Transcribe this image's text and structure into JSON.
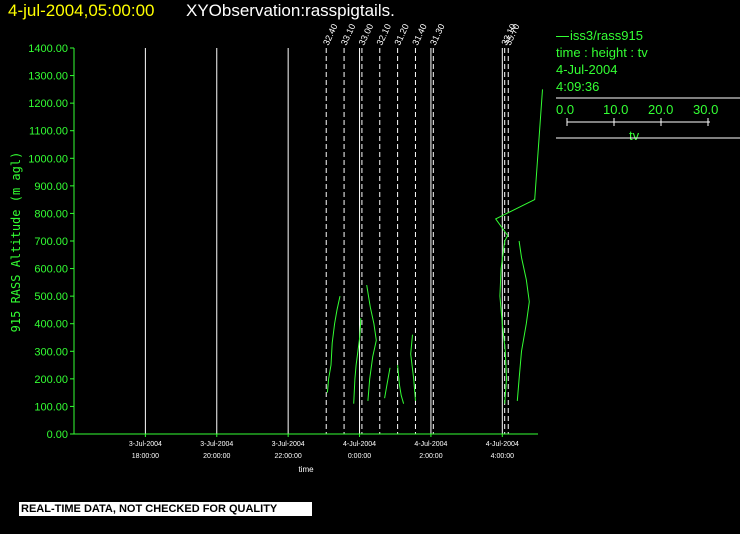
{
  "header": {
    "time_label": "4-jul-2004,05:00:00",
    "observation_label": "XYObservation:rasspigtails."
  },
  "legend": {
    "series_label": "iss3/rass915",
    "axes_label": "time : height : tv",
    "date": "4-Jul-2004",
    "time": "4:09:36",
    "scale_ticks": [
      "0.0",
      "10.0",
      "20.0",
      "30.0"
    ],
    "scale_label": "tv"
  },
  "footer": {
    "warning": "REAL-TIME DATA, NOT CHECKED FOR QUALITY"
  },
  "colors": {
    "background": "#000000",
    "axis": "#33ff33",
    "grid": "#ffffff",
    "data": "#33ff33",
    "title_time": "#ffff00",
    "title_obs": "#ffffff"
  },
  "chart_data": {
    "type": "line",
    "xlabel": "time",
    "ylabel": "915 RASS Altitude (m agl)",
    "ylim": [
      0,
      1400
    ],
    "xlim": [
      "2004-07-03 16:00",
      "2004-07-04 05:00"
    ],
    "y_ticks": [
      "0.00",
      "100.00",
      "200.00",
      "300.00",
      "400.00",
      "500.00",
      "600.00",
      "700.00",
      "800.00",
      "900.00",
      "1000.00",
      "1100.00",
      "1200.00",
      "1300.00",
      "1400.00"
    ],
    "x_ticks": [
      {
        "date": "3-Jul-2004",
        "time": "18:00:00",
        "x": "2004-07-03 18:00"
      },
      {
        "date": "3-Jul-2004",
        "time": "20:00:00",
        "x": "2004-07-03 20:00"
      },
      {
        "date": "3-Jul-2004",
        "time": "22:00:00",
        "x": "2004-07-03 22:00"
      },
      {
        "date": "4-Jul-2004",
        "time": "0:00:00",
        "x": "2004-07-04 00:00"
      },
      {
        "date": "4-Jul-2004",
        "time": "2:00:00",
        "x": "2004-07-04 02:00"
      },
      {
        "date": "4-Jul-2004",
        "time": "4:00:00",
        "x": "2004-07-04 04:00"
      }
    ],
    "profiles": [
      {
        "label": "32.40",
        "x": "2004-07-03 23:04",
        "points": [
          [
            0.2,
            150
          ],
          [
            0.4,
            200
          ],
          [
            0.8,
            250
          ],
          [
            1.0,
            330
          ],
          [
            1.4,
            400
          ],
          [
            1.8,
            450
          ],
          [
            2.3,
            500
          ]
        ]
      },
      {
        "label": "33.10",
        "x": "2004-07-03 23:34",
        "points": [
          [
            1.6,
            110
          ],
          [
            1.8,
            200
          ],
          [
            2.0,
            250
          ],
          [
            2.3,
            300
          ],
          [
            2.6,
            350
          ],
          [
            2.8,
            420
          ]
        ]
      },
      {
        "label": "33.00",
        "x": "2004-07-04 00:04",
        "points": [
          [
            1.0,
            120
          ],
          [
            1.3,
            200
          ],
          [
            1.8,
            280
          ],
          [
            2.4,
            340
          ],
          [
            2.0,
            400
          ],
          [
            1.4,
            460
          ],
          [
            0.8,
            540
          ]
        ]
      },
      {
        "label": "32.10",
        "x": "2004-07-04 00:34",
        "points": [
          [
            0.8,
            130
          ],
          [
            1.2,
            180
          ],
          [
            1.7,
            240
          ]
        ]
      },
      {
        "label": "31.20",
        "x": "2004-07-04 01:04",
        "points": [
          [
            0.0,
            250
          ],
          [
            0.3,
            180
          ],
          [
            0.6,
            140
          ],
          [
            1.0,
            110
          ]
        ]
      },
      {
        "label": "31.40",
        "x": "2004-07-04 01:34",
        "points": [
          [
            0.0,
            120
          ],
          [
            -0.3,
            200
          ],
          [
            -0.8,
            290
          ],
          [
            -0.5,
            360
          ]
        ]
      },
      {
        "label": "31.30",
        "x": "2004-07-04 02:04",
        "points": []
      },
      {
        "label": "33.10",
        "x": "2004-07-04 04:04",
        "points": [
          [
            0.0,
            110
          ],
          [
            0.3,
            200
          ],
          [
            0.1,
            300
          ],
          [
            -0.4,
            400
          ],
          [
            -0.8,
            500
          ],
          [
            -0.6,
            600
          ],
          [
            0.0,
            700
          ],
          [
            0.5,
            720
          ],
          [
            -1.5,
            780
          ],
          [
            5.0,
            850
          ],
          [
            6.3,
            1250
          ]
        ]
      },
      {
        "label": "35.70",
        "x": "2004-07-04 04:10",
        "points": [
          [
            1.5,
            120
          ],
          [
            1.8,
            200
          ],
          [
            2.2,
            300
          ],
          [
            3.0,
            400
          ],
          [
            3.5,
            480
          ],
          [
            3.0,
            560
          ],
          [
            2.2,
            640
          ],
          [
            1.8,
            700
          ]
        ]
      }
    ]
  }
}
